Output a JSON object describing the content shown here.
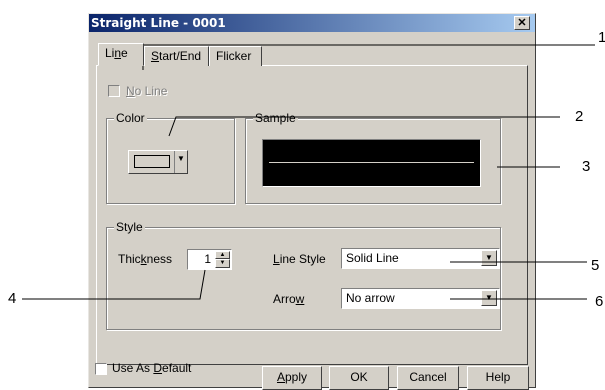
{
  "window": {
    "title": "Straight Line - 0001",
    "close_glyph": "✕"
  },
  "tabs": [
    {
      "label_pre": "Li",
      "label_key": "n",
      "label_post": "e"
    },
    {
      "label_pre": "",
      "label_key": "S",
      "label_post": "tart/End"
    },
    {
      "label_pre": "",
      "label_key": "",
      "label_post": "Flicker"
    }
  ],
  "no_line": {
    "label_key": "N",
    "label_rest": "o Line",
    "checked": false
  },
  "color_group": {
    "label": "Color",
    "swatch_color": "#d4d0c8"
  },
  "sample_group": {
    "label": "Sample"
  },
  "style_group": {
    "label": "Style",
    "thickness_pre": "Thic",
    "thickness_key": "k",
    "thickness_post": "ness",
    "thickness_value": "1",
    "line_style_key": "L",
    "line_style_rest": "ine Style",
    "line_style_value": "Solid Line",
    "arrow_pre": "Arro",
    "arrow_key": "w",
    "arrow_value": "No arrow"
  },
  "use_default": {
    "label_pre": "Use As ",
    "label_key": "D",
    "label_post": "efault",
    "checked": false
  },
  "buttons": {
    "apply_key": "A",
    "apply_rest": "pply",
    "ok": "OK",
    "cancel": "Cancel",
    "help": "Help"
  },
  "callouts": [
    "1",
    "2",
    "3",
    "4",
    "5",
    "6"
  ],
  "icons": {
    "dropdown": "▼",
    "spin_up": "▲",
    "spin_down": "▼"
  }
}
